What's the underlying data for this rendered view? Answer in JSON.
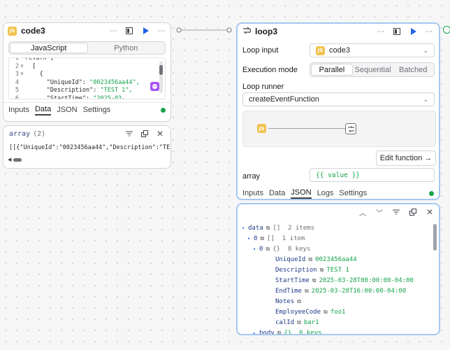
{
  "connector": {},
  "code_node": {
    "title": "code3",
    "badge": "JS",
    "lang_tabs": [
      "JavaScript",
      "Python"
    ],
    "code_lines": [
      {
        "n": "1",
        "fold": "",
        "text": "return ["
      },
      {
        "n": "2",
        "fold": "v",
        "text": "  ["
      },
      {
        "n": "3",
        "fold": "v",
        "text": "    {"
      },
      {
        "n": "4",
        "fold": "",
        "key": "      \"UniqueId\": ",
        "val": "\"0023456aa44\","
      },
      {
        "n": "5",
        "fold": "",
        "key": "      \"Description\": ",
        "val": "\"TEST 1\","
      },
      {
        "n": "6",
        "fold": "",
        "key": "      \"StartTime\": ",
        "val": "\"2025-03-"
      }
    ],
    "tabs": [
      "Inputs",
      "Data",
      "JSON",
      "Settings"
    ],
    "active_tab": "Data"
  },
  "array_panel": {
    "title": "array",
    "count": "(2)",
    "content": "[[{\"UniqueId\":\"0023456aa44\",\"Description\":\"TE"
  },
  "loop_node": {
    "title": "loop3",
    "loop_input_label": "Loop input",
    "loop_input_value": "code3",
    "loop_input_badge": "JS",
    "mode_label": "Execution mode",
    "modes": [
      "Parallel",
      "Sequential",
      "Batched"
    ],
    "active_mode": "Parallel",
    "runner_label": "Loop runner",
    "runner_value": "createEventFunction",
    "edit_button": "Edit function →",
    "array_label": "array",
    "array_value": "{{ value }}",
    "tabs": [
      "Inputs",
      "Data",
      "JSON",
      "Logs",
      "Settings"
    ],
    "active_tab": "JSON"
  },
  "json_panel": {
    "rows": [
      {
        "indent": 0,
        "tri": "▾",
        "key": "data",
        "meta": "[]",
        "info": "2 items"
      },
      {
        "indent": 1,
        "tri": "▾",
        "key": "0",
        "meta": "[]",
        "info": "1 item"
      },
      {
        "indent": 2,
        "tri": "▾",
        "key": "0",
        "meta": "{}",
        "info": "8 keys"
      },
      {
        "indent": 3,
        "key": "UniqueId",
        "val": "0023456aa44"
      },
      {
        "indent": 3,
        "key": "Description",
        "val": "TEST 1"
      },
      {
        "indent": 3,
        "key": "StartTime",
        "val": "2025-03-28T08:00:00-04:00"
      },
      {
        "indent": 3,
        "key": "EndTime",
        "val": "2025-03-28T16:00:00-04:00"
      },
      {
        "indent": 3,
        "key": "Notes",
        "val": ""
      },
      {
        "indent": 3,
        "key": "EmployeeCode",
        "val": "foo1"
      },
      {
        "indent": 3,
        "key": "calId",
        "val": "bar1"
      },
      {
        "indent": 2,
        "tri": "▸",
        "key": "body",
        "meta": "{}",
        "info": "6 keys",
        "greenMeta": true
      }
    ]
  },
  "colors": {
    "accent": "#2563eb",
    "success": "#16a34a",
    "js_badge": "#f1c24c",
    "selection": "#a5c8f0"
  }
}
